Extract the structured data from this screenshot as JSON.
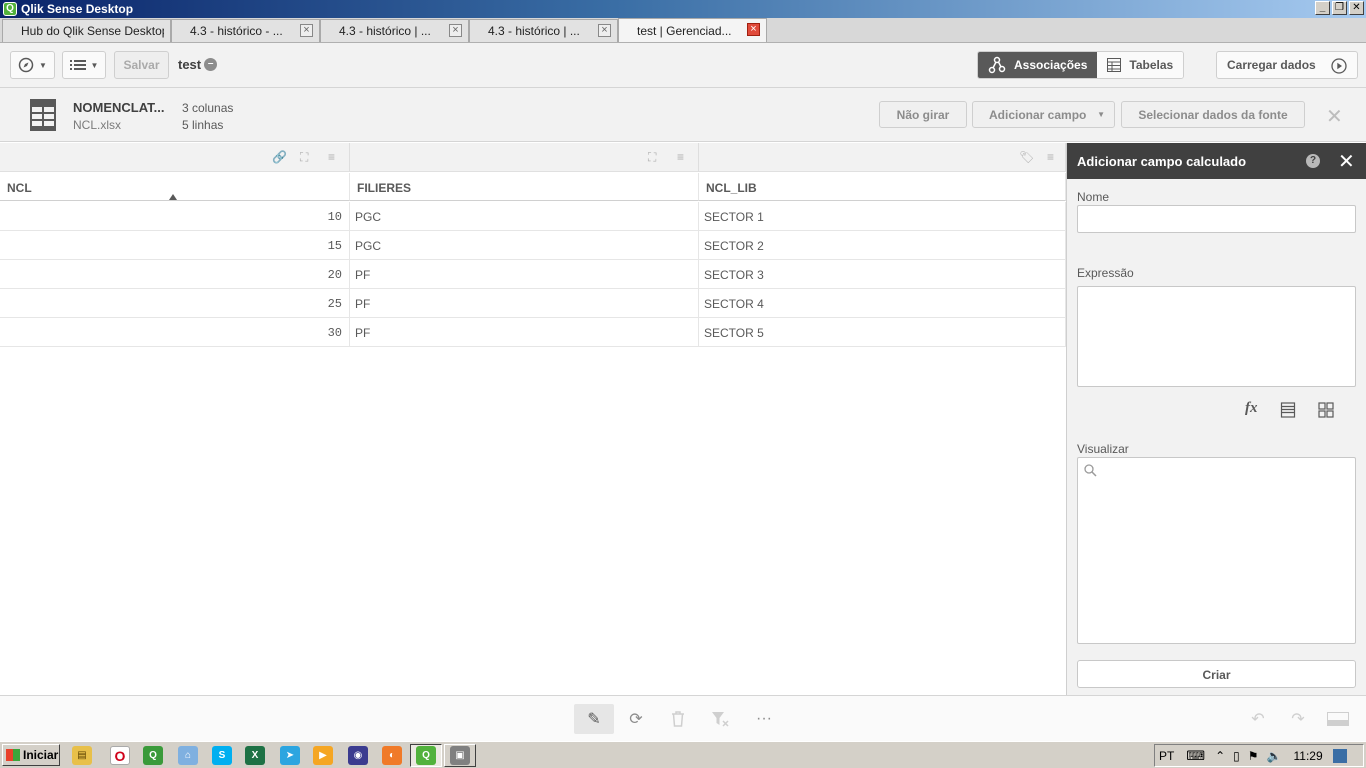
{
  "window": {
    "title": "Qlik Sense Desktop"
  },
  "tabs": [
    {
      "label": "Hub do Qlik Sense Desktop",
      "closable": false
    },
    {
      "label": "4.3 - histórico - ...",
      "closable": true
    },
    {
      "label": "4.3 - histórico | ...",
      "closable": true
    },
    {
      "label": "4.3 - histórico | ...",
      "closable": true
    },
    {
      "label": "test | Gerenciad...",
      "closable": true,
      "active": true
    }
  ],
  "toolbar": {
    "save_label": "Salvar",
    "app_name": "test",
    "associations_label": "Associações",
    "tables_label": "Tabelas",
    "load_data_label": "Carregar dados"
  },
  "table_info": {
    "name": "NOMENCLAT...",
    "file": "NCL.xlsx",
    "columns": "3 colunas",
    "rows": "5 linhas",
    "no_pivot_label": "Não girar",
    "add_field_label": "Adicionar campo",
    "select_source_label": "Selecionar dados da fonte"
  },
  "grid": {
    "columns": [
      "NCL",
      "FILIERES",
      "NCL_LIB"
    ],
    "rows": [
      [
        "10",
        "PGC",
        "SECTOR 1"
      ],
      [
        "15",
        "PGC",
        "SECTOR 2"
      ],
      [
        "20",
        "PF",
        "SECTOR 3"
      ],
      [
        "25",
        "PF",
        "SECTOR 4"
      ],
      [
        "30",
        "PF",
        "SECTOR 5"
      ]
    ]
  },
  "panel": {
    "title": "Adicionar campo calculado",
    "name_label": "Nome",
    "name_value": "",
    "expression_label": "Expressão",
    "expression_value": "",
    "preview_label": "Visualizar",
    "create_label": "Criar"
  },
  "taskbar": {
    "start_label": "Iniciar",
    "language": "PT",
    "clock": "11:29"
  }
}
